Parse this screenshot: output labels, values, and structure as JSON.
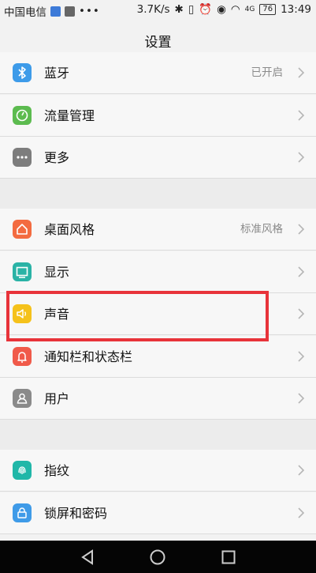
{
  "status": {
    "carrier": "中国电信",
    "speed": "3.7K/s",
    "network": "4G",
    "battery": "76",
    "time": "13:49"
  },
  "title": "设置",
  "group1": [
    {
      "label": "蓝牙",
      "value": "已开启",
      "icon": "bluetooth-icon",
      "color": "#3d9be9"
    },
    {
      "label": "流量管理",
      "value": "",
      "icon": "data-usage-icon",
      "color": "#5cbb4f"
    },
    {
      "label": "更多",
      "value": "",
      "icon": "more-dots-icon",
      "color": "#7d7d7d"
    }
  ],
  "group2": [
    {
      "label": "桌面风格",
      "value": "标准风格",
      "icon": "home-icon",
      "color": "#f36b40"
    },
    {
      "label": "显示",
      "value": "",
      "icon": "display-icon",
      "color": "#2ab3a6"
    },
    {
      "label": "声音",
      "value": "",
      "icon": "speaker-icon",
      "color": "#f5c21b"
    },
    {
      "label": "通知栏和状态栏",
      "value": "",
      "icon": "notification-bell-icon",
      "color": "#f05a4a"
    },
    {
      "label": "用户",
      "value": "",
      "icon": "user-icon",
      "color": "#8a8a8a"
    }
  ],
  "group3": [
    {
      "label": "指纹",
      "value": "",
      "icon": "fingerprint-icon",
      "color": "#20b7a8"
    },
    {
      "label": "锁屏和密码",
      "value": "",
      "icon": "lock-icon",
      "color": "#3f9be8"
    }
  ],
  "highlight_color": "#e8333a"
}
